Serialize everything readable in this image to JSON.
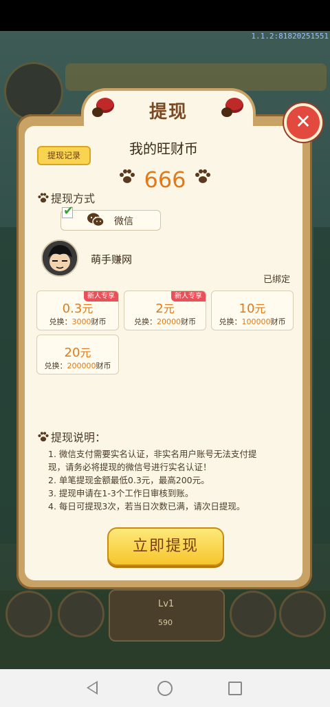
{
  "version": "1.1.2:81820251551",
  "dialog": {
    "title": "提现",
    "close_symbol": "✕",
    "record_button": "提现记录",
    "coin_title": "我的旺财币",
    "coin_amount": "666",
    "method_label": "提现方式",
    "wechat_label": "微信",
    "username": "萌手赚网",
    "bound_status": "已绑定",
    "options": [
      {
        "amount": "0.3",
        "unit": "元",
        "exchange_prefix": "兑换：",
        "exchange_value": "3000",
        "exchange_suffix": "财币",
        "tag": "新人专享"
      },
      {
        "amount": "2",
        "unit": "元",
        "exchange_prefix": "兑换：",
        "exchange_value": "20000",
        "exchange_suffix": "财币",
        "tag": "新人专享"
      },
      {
        "amount": "10",
        "unit": "元",
        "exchange_prefix": "兑换：",
        "exchange_value": "100000",
        "exchange_suffix": "财币",
        "tag": ""
      },
      {
        "amount": "20",
        "unit": "元",
        "exchange_prefix": "兑换：",
        "exchange_value": "200000",
        "exchange_suffix": "财币",
        "tag": ""
      }
    ],
    "notes_title": "提现说明：",
    "notes": [
      "1. 微信支付需要实名认证，非实名用户账号无法支付提",
      "现，请务必将提现的微信号进行实名认证！",
      "2. 单笔提现金额最低0.3元，最高200元。",
      "3. 提现申请在1-3个工作日审核到账。",
      "4. 每日可提现3次，若当日次数已满，请次日提现。"
    ],
    "submit_button": "立即提现"
  },
  "background": {
    "pet_level": "Lv1",
    "pet_coins": "590"
  },
  "colors": {
    "accent_orange": "#e17a1a",
    "close_red": "#e34a3f",
    "button_yellow": "#f6c52d",
    "tag_red": "#e8505a"
  }
}
